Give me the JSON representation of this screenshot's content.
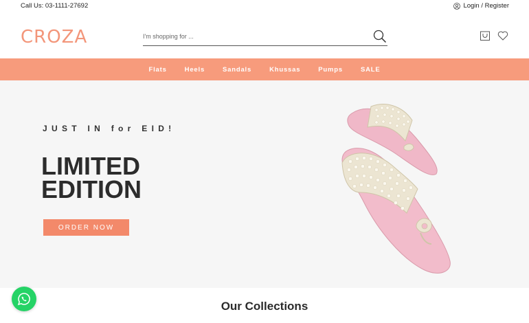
{
  "topbar": {
    "call_text": "Call Us: 03-1111-27692",
    "account_text": "Login / Register"
  },
  "header": {
    "logo": "CROZA",
    "search_placeholder": "I'm shopping for ...",
    "icons": [
      "search-icon",
      "cart-icon",
      "heart-icon",
      "user-icon"
    ]
  },
  "nav": {
    "items": [
      {
        "label": "Flats"
      },
      {
        "label": "Heels"
      },
      {
        "label": "Sandals"
      },
      {
        "label": "Khussas"
      },
      {
        "label": "Pumps"
      },
      {
        "label": "SALE"
      }
    ]
  },
  "hero": {
    "tagline": "JUST IN for EID!",
    "headline_line1": "LIMITED",
    "headline_line2": "EDITION",
    "cta": "ORDER NOW"
  },
  "collections": {
    "title": "Our Collections"
  },
  "colors": {
    "brand": "#f3967a",
    "nav_bg": "#f79b7c",
    "cta_bg": "#f3896a",
    "hero_bg": "#f6f6f6",
    "whatsapp": "#25d366"
  }
}
